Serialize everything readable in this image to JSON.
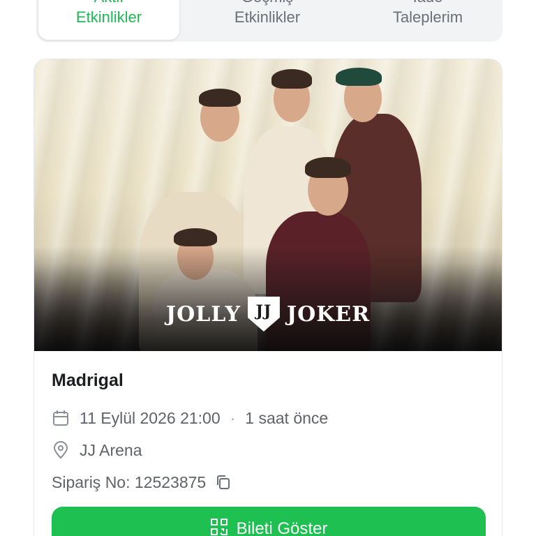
{
  "tabs": [
    {
      "label_line1": "Aktif",
      "label_line2": "Etkinlikler",
      "active": true
    },
    {
      "label_line1": "Geçmiş",
      "label_line2": "Etkinlikler",
      "active": false
    },
    {
      "label_line1": "İade",
      "label_line2": "Taleplerim",
      "active": false
    }
  ],
  "event": {
    "poster_logo_left": "JOLLY",
    "poster_logo_mark": "JJ",
    "poster_logo_right": "JOKER",
    "title": "Madrigal",
    "date_time": "11 Eylül 2026 21:00",
    "relative_time": "1 saat önce",
    "separator": "·",
    "venue": "JJ Arena",
    "order_number": "Sipariş No: 12523875",
    "show_ticket_label": "Bileti Göster"
  },
  "colors": {
    "accent": "#1ec151",
    "active_tab_text": "#1db954",
    "muted_text": "#5f6368"
  },
  "icons": [
    "calendar-icon",
    "location-pin-icon",
    "copy-icon",
    "qr-code-icon"
  ]
}
